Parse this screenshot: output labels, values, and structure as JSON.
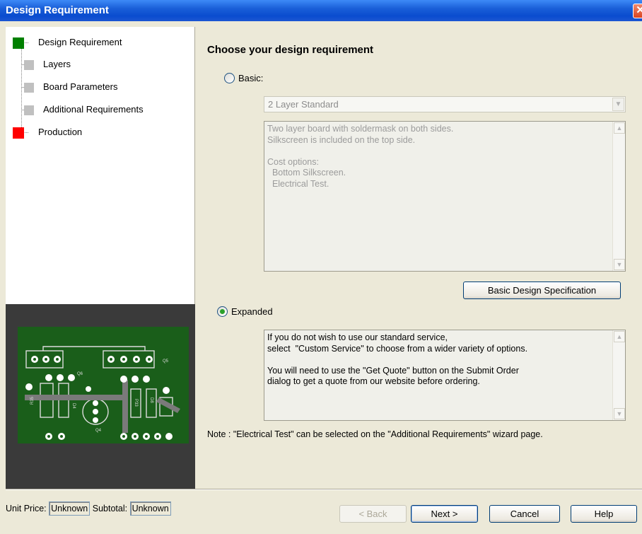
{
  "window": {
    "title": "Design Requirement",
    "close_glyph": "✕"
  },
  "tree": [
    {
      "label": "Design Requirement",
      "color": "#008000"
    },
    {
      "label": "Layers",
      "color": "#c0c0c0"
    },
    {
      "label": "Board Parameters",
      "color": "#c0c0c0"
    },
    {
      "label": "Additional Requirements",
      "color": "#c0c0c0"
    },
    {
      "label": "Production",
      "color": "#ff0000"
    }
  ],
  "main": {
    "heading": "Choose your design requirement",
    "basic": {
      "label": "Basic:",
      "selected": false,
      "select_value": "2 Layer Standard",
      "description": "Two layer board with soldermask on both sides.\nSilkscreen is included on the top side.\n\nCost options:\n  Bottom Silkscreen.\n  Electrical Test.",
      "spec_button": "Basic Design Specification"
    },
    "expanded": {
      "label": "Expanded",
      "selected": true,
      "description": "If you do not wish to use our standard service,\nselect  \"Custom Service\" to choose from a wider variety of options.\n\nYou will need to use the \"Get Quote\" button on the Submit Order\ndialog to get a quote from our website before ordering."
    },
    "note": "Note : \"Electrical Test\" can be selected on the \"Additional Requirements\" wizard page."
  },
  "pcb_silk": {
    "q6": "Q6",
    "q5": "Q5",
    "q4": "Q4",
    "r35": "R35",
    "d4": "D4",
    "p33": "P33",
    "d8": "D8"
  },
  "footer": {
    "unit_price_label": "Unit Price:",
    "unit_price_value": "Unknown",
    "subtotal_label": "Subtotal:",
    "subtotal_value": "Unknown",
    "back": "< Back",
    "next": "Next >",
    "cancel": "Cancel",
    "help": "Help"
  },
  "icons": {
    "scroll_up": "up-arrow-icon",
    "scroll_down": "down-arrow-icon",
    "dropdown": "chevron-down-icon"
  }
}
